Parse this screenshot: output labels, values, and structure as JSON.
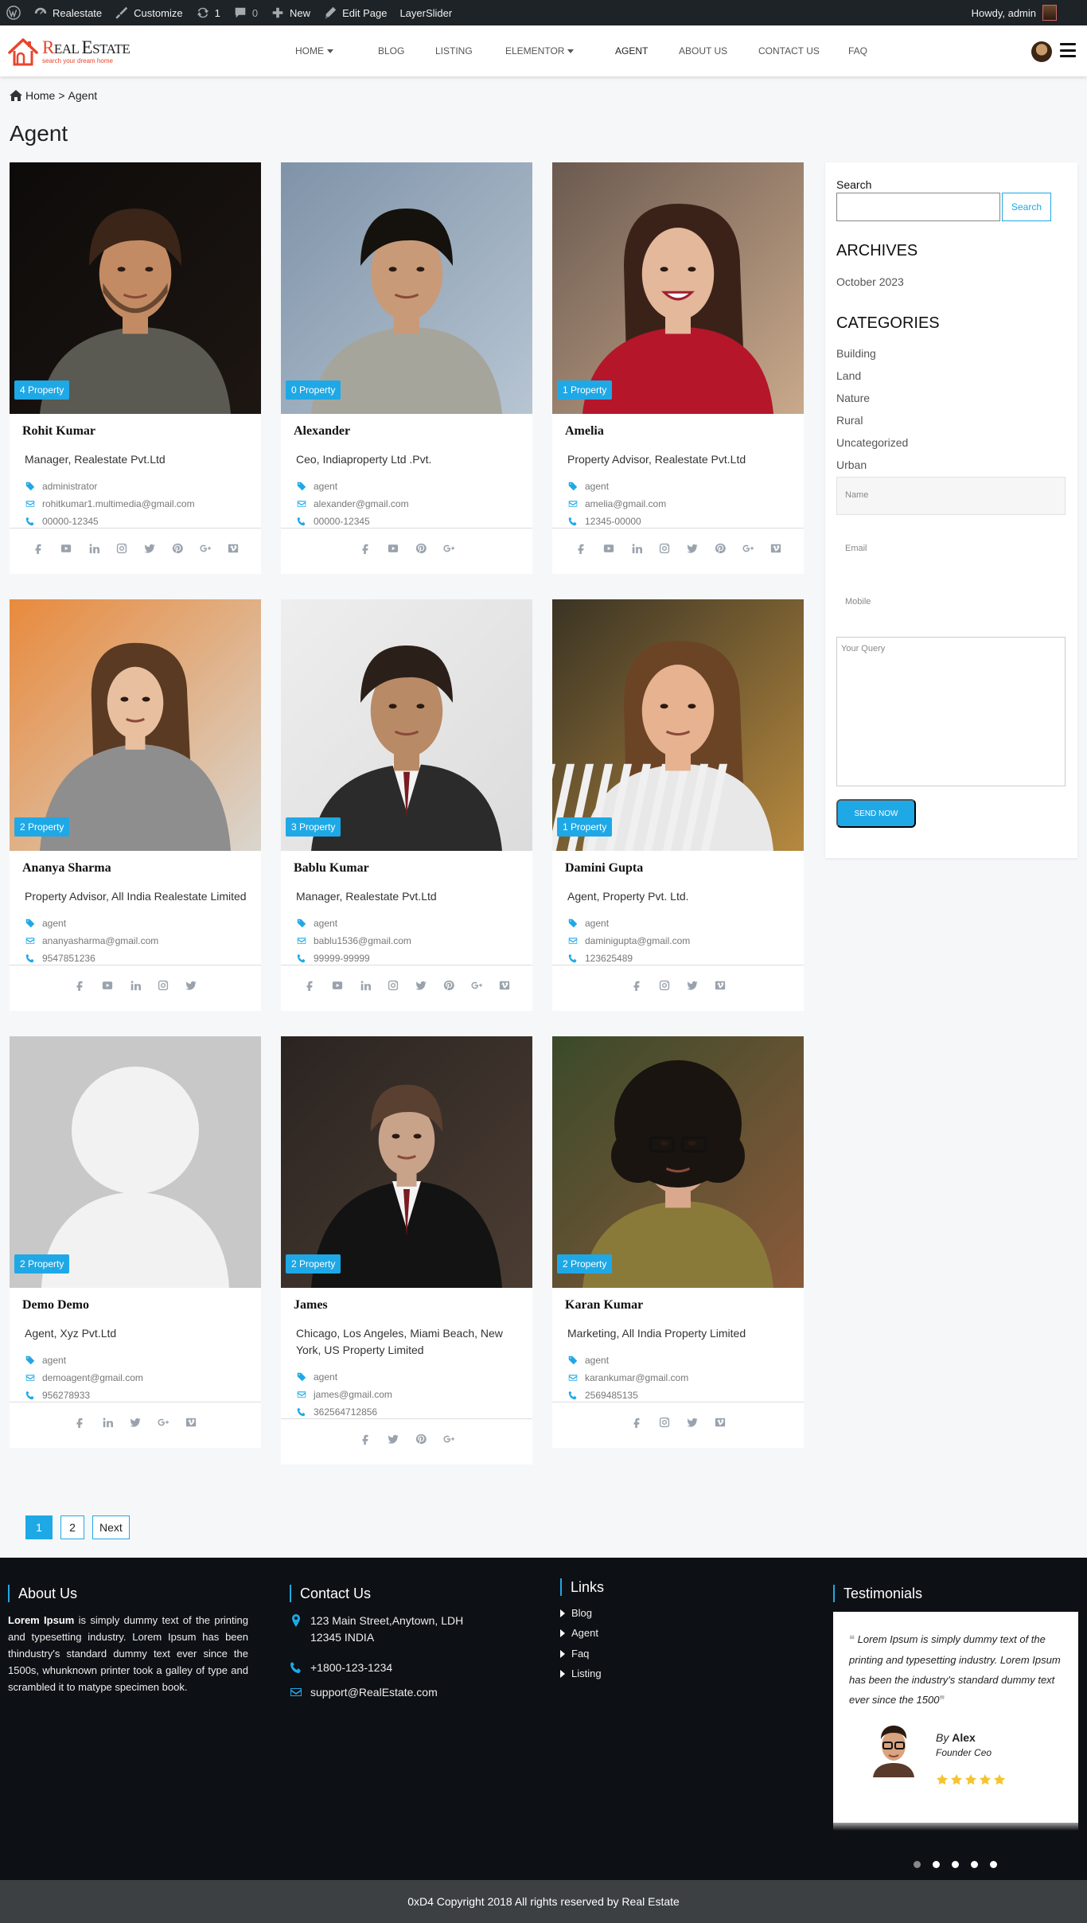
{
  "adminbar": {
    "site": "Realestate",
    "customize": "Customize",
    "updates_count": "1",
    "comments_count": "0",
    "new": "New",
    "edit_page": "Edit Page",
    "layerslider": "LayerSlider",
    "howdy": "Howdy, admin"
  },
  "logo": {
    "brand_big": "R",
    "brand_rest_1": "EAL ",
    "brand_big2": "E",
    "brand_rest_2": "STATE",
    "tagline": "search your dream home"
  },
  "nav": [
    {
      "label": "HOME",
      "dropdown": true
    },
    {
      "label": "BLOG"
    },
    {
      "label": "LISTING"
    },
    {
      "label": "ELEMENTOR",
      "dropdown": true
    },
    {
      "label": "AGENT",
      "active": true
    },
    {
      "label": "ABOUT US"
    },
    {
      "label": "CONTACT US"
    },
    {
      "label": "FAQ"
    }
  ],
  "breadcrumb": {
    "home": "Home",
    "sep": ">",
    "current": "Agent"
  },
  "page_title": "Agent",
  "agents": [
    {
      "name": "Rohit Kumar",
      "title": "Manager, Realestate Pvt.Ltd",
      "role": "administrator",
      "email": "rohitkumar1.multimedia@gmail.com",
      "phone": "00000-12345",
      "properties": "4 Property",
      "socials": [
        "facebook",
        "youtube",
        "linkedin",
        "instagram",
        "twitter",
        "pinterest",
        "google-plus",
        "vimeo"
      ]
    },
    {
      "name": "Alexander",
      "title": "Ceo, Indiaproperty Ltd .Pvt.",
      "role": "agent",
      "email": "alexander@gmail.com",
      "phone": "00000-12345",
      "properties": "0 Property",
      "socials": [
        "facebook",
        "youtube",
        "pinterest",
        "google-plus"
      ]
    },
    {
      "name": "Amelia",
      "title": "Property Advisor, Realestate Pvt.Ltd",
      "role": "agent",
      "email": "amelia@gmail.com",
      "phone": "12345-00000",
      "properties": "1 Property",
      "socials": [
        "facebook",
        "youtube",
        "linkedin",
        "instagram",
        "twitter",
        "pinterest",
        "google-plus",
        "vimeo"
      ]
    },
    {
      "name": "Ananya Sharma",
      "title": "Property Advisor, All India Realestate Limited",
      "role": "agent",
      "email": "ananyasharma@gmail.com",
      "phone": "9547851236",
      "properties": "2 Property",
      "socials": [
        "facebook",
        "youtube",
        "linkedin",
        "instagram",
        "twitter"
      ]
    },
    {
      "name": "Bablu Kumar",
      "title": "Manager, Realestate Pvt.Ltd",
      "role": "agent",
      "email": "bablu1536@gmail.com",
      "phone": "99999-99999",
      "properties": "3 Property",
      "socials": [
        "facebook",
        "youtube",
        "linkedin",
        "instagram",
        "twitter",
        "pinterest",
        "google-plus",
        "vimeo"
      ]
    },
    {
      "name": "Damini Gupta",
      "title": "Agent, Property Pvt. Ltd.",
      "role": "agent",
      "email": "daminigupta@gmail.com",
      "phone": "123625489",
      "properties": "1 Property",
      "socials": [
        "facebook",
        "instagram",
        "twitter",
        "vimeo"
      ]
    },
    {
      "name": "Demo Demo",
      "title": "Agent, Xyz Pvt.Ltd",
      "role": "agent",
      "email": "demoagent@gmail.com",
      "phone": "956278933",
      "properties": "2 Property",
      "socials": [
        "facebook",
        "linkedin",
        "twitter",
        "google-plus",
        "vimeo"
      ]
    },
    {
      "name": "James",
      "title": "Chicago, Los Angeles, Miami Beach, New York, US Property Limited",
      "role": "agent",
      "email": "james@gmail.com",
      "phone": "362564712856",
      "properties": "2 Property",
      "socials": [
        "facebook",
        "twitter",
        "pinterest",
        "google-plus"
      ]
    },
    {
      "name": "Karan Kumar",
      "title": "Marketing, All India Property Limited",
      "role": "agent",
      "email": "karankumar@gmail.com",
      "phone": "2569485135",
      "properties": "2 Property",
      "socials": [
        "facebook",
        "instagram",
        "twitter",
        "vimeo"
      ]
    }
  ],
  "sidebar": {
    "search_label": "Search",
    "search_button": "Search",
    "search_value": "",
    "archives_title": "ARCHIVES",
    "archives": [
      "October 2023"
    ],
    "categories_title": "CATEGORIES",
    "categories": [
      "Building",
      "Land",
      "Nature",
      "Rural",
      "Uncategorized",
      "Urban"
    ],
    "form": {
      "name_placeholder": "Name",
      "email_placeholder": "Email",
      "mobile_placeholder": "Mobile",
      "query_placeholder": "Your Query",
      "send_label": "SEND NOW"
    }
  },
  "pagination": {
    "pages": [
      "1",
      "2"
    ],
    "current": "1",
    "next": "Next"
  },
  "footer": {
    "about_title": "About Us",
    "about_lead": "Lorem Ipsum",
    "about_text": " is simply dummy text of the printing and typesetting industry. Lorem Ipsum has been thindustry's standard dummy text ever since the 1500s, whunknown printer took a galley of type and scrambled it to matype specimen book.",
    "contact_title": "Contact Us",
    "address_line1": "123 Main Street,Anytown, LDH",
    "address_line2": "12345 INDIA",
    "phone": "+1800-123-1234",
    "email": "support@RealEstate.com",
    "links_title": "Links",
    "links": [
      "Blog",
      "Agent",
      "Faq",
      "Listing"
    ],
    "testimonials_title": "Testimonials",
    "testimonial": {
      "quote": "Lorem Ipsum is simply dummy text of the printing and typesetting industry. Lorem Ipsum has been the industry's standard dummy text ever since the 1500",
      "by": "By",
      "name": "Alex",
      "role": "Founder Ceo",
      "rating": 5,
      "slides": 5,
      "active_slide": 1
    },
    "copyright": "0xD4 Copyright 2018 All rights reserved by Real Estate"
  },
  "colors": {
    "accent": "#1fa8e6",
    "brand": "#e8452b",
    "footer_bg": "#0d1014",
    "copyright_bg": "#3d4043"
  }
}
